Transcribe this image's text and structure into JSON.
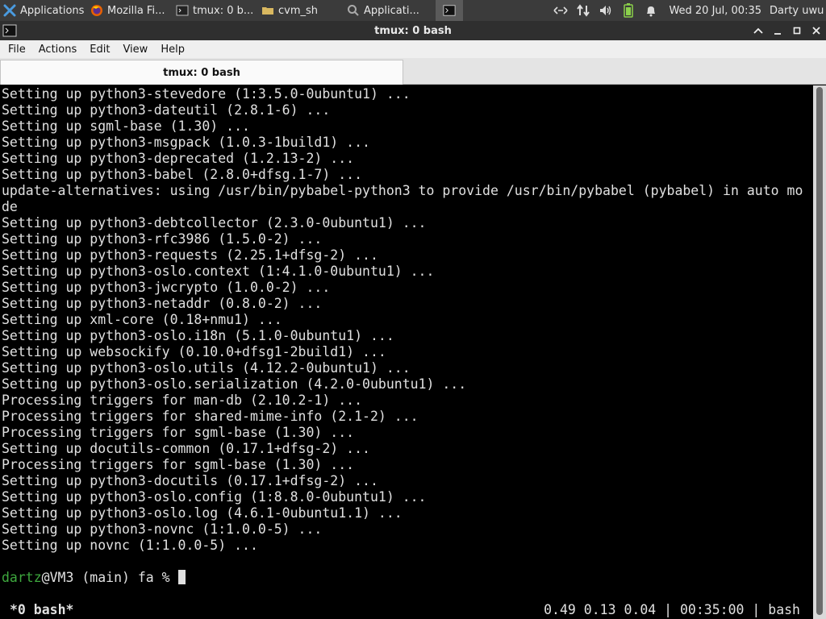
{
  "panel": {
    "tasks": [
      {
        "label": "Applications",
        "icon": "xfce-icon"
      },
      {
        "label": "Mozilla Fi...",
        "icon": "firefox-icon"
      },
      {
        "label": "tmux: 0 b...",
        "icon": "terminal-icon"
      },
      {
        "label": "cvm_sh",
        "icon": "folder-icon"
      },
      {
        "label": "Applicati...",
        "icon": "search-icon"
      }
    ],
    "clock": "Wed 20 Jul, 00:35",
    "user": "Darty uwu"
  },
  "window": {
    "title": "tmux: 0 bash"
  },
  "menu": [
    "File",
    "Actions",
    "Edit",
    "View",
    "Help"
  ],
  "tab": {
    "label": "tmux: 0 bash"
  },
  "terminal": {
    "lines": [
      "Setting up python3-stevedore (1:3.5.0-0ubuntu1) ...",
      "Setting up python3-dateutil (2.8.1-6) ...",
      "Setting up sgml-base (1.30) ...",
      "Setting up python3-msgpack (1.0.3-1build1) ...",
      "Setting up python3-deprecated (1.2.13-2) ...",
      "Setting up python3-babel (2.8.0+dfsg.1-7) ...",
      "update-alternatives: using /usr/bin/pybabel-python3 to provide /usr/bin/pybabel (pybabel) in auto mo",
      "de",
      "Setting up python3-debtcollector (2.3.0-0ubuntu1) ...",
      "Setting up python3-rfc3986 (1.5.0-2) ...",
      "Setting up python3-requests (2.25.1+dfsg-2) ...",
      "Setting up python3-oslo.context (1:4.1.0-0ubuntu1) ...",
      "Setting up python3-jwcrypto (1.0.0-2) ...",
      "Setting up python3-netaddr (0.8.0-2) ...",
      "Setting up xml-core (0.18+nmu1) ...",
      "Setting up python3-oslo.i18n (5.1.0-0ubuntu1) ...",
      "Setting up websockify (0.10.0+dfsg1-2build1) ...",
      "Setting up python3-oslo.utils (4.12.2-0ubuntu1) ...",
      "Setting up python3-oslo.serialization (4.2.0-0ubuntu1) ...",
      "Processing triggers for man-db (2.10.2-1) ...",
      "Processing triggers for shared-mime-info (2.1-2) ...",
      "Processing triggers for sgml-base (1.30) ...",
      "Setting up docutils-common (0.17.1+dfsg-2) ...",
      "Processing triggers for sgml-base (1.30) ...",
      "Setting up python3-docutils (0.17.1+dfsg-2) ...",
      "Setting up python3-oslo.config (1:8.8.0-0ubuntu1) ...",
      "Setting up python3-oslo.log (4.6.1-0ubuntu1.1) ...",
      "Setting up python3-novnc (1:1.0.0-5) ...",
      "Setting up novnc (1:1.0.0-5) ...",
      ""
    ],
    "prompt": {
      "user": "dartz",
      "rest": "@VM3 (main) fa % "
    }
  },
  "tmux_status": {
    "left": "*0 bash*",
    "right": "0.49 0.13 0.04 | 00:35:00 | bash"
  },
  "colors": {
    "panel_bg": "#3b3b3b",
    "terminal_bg": "#000000",
    "terminal_fg": "#e0e0e0",
    "prompt_user": "#3ea83e"
  }
}
